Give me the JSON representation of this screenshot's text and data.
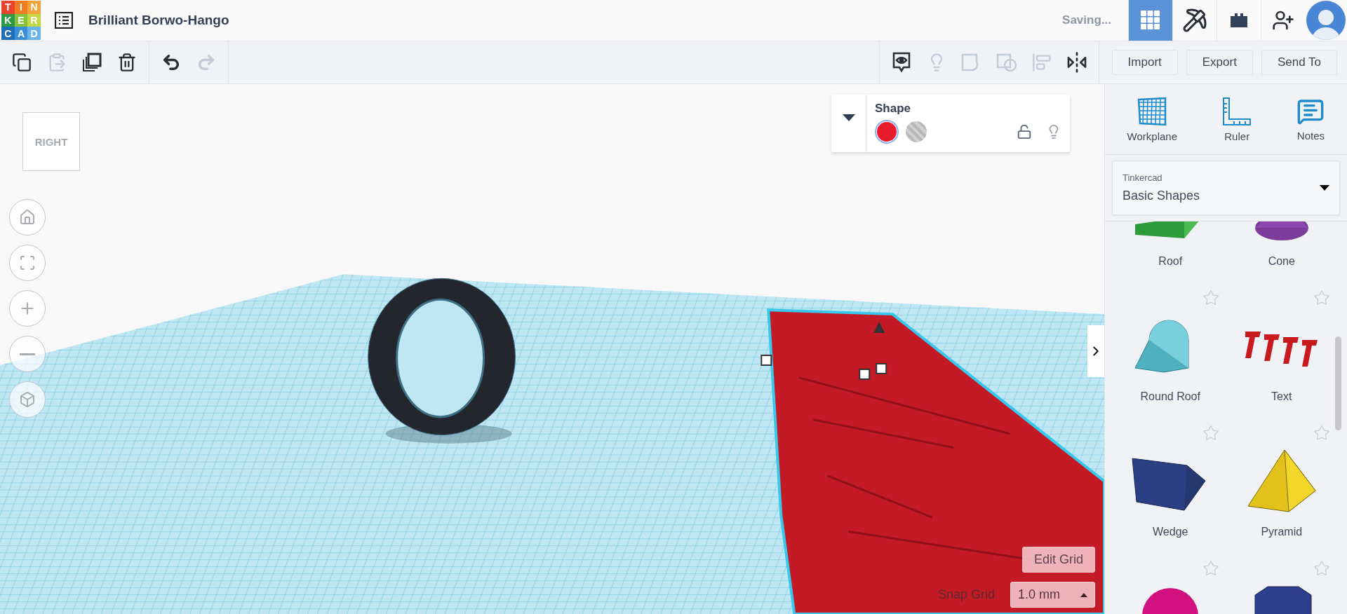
{
  "logo": {
    "letters": [
      "T",
      "I",
      "N",
      "K",
      "E",
      "R",
      "C",
      "A",
      "D"
    ]
  },
  "title": "Brilliant Borwo-Hango",
  "save_status": "Saving...",
  "top_nav": [
    {
      "kind": "grid",
      "selected": true
    },
    {
      "kind": "pickaxe",
      "selected": false
    },
    {
      "kind": "bricks",
      "selected": false
    },
    {
      "kind": "add-user",
      "selected": false
    }
  ],
  "edit_tools": [
    {
      "kind": "copy",
      "disabled": false
    },
    {
      "kind": "paste",
      "disabled": true
    },
    {
      "kind": "duplicate",
      "disabled": false
    },
    {
      "kind": "delete",
      "disabled": false
    }
  ],
  "history_tools": [
    {
      "kind": "undo",
      "disabled": false
    },
    {
      "kind": "redo",
      "disabled": true
    }
  ],
  "view_tools": [
    {
      "kind": "notes-visibility",
      "disabled": false
    },
    {
      "kind": "hint",
      "disabled": true
    },
    {
      "kind": "group",
      "disabled": true
    },
    {
      "kind": "ungroup",
      "disabled": true
    },
    {
      "kind": "align",
      "disabled": true
    },
    {
      "kind": "mirror",
      "disabled": false
    }
  ],
  "buttons": [
    "Import",
    "Export",
    "Send To"
  ],
  "view_cube": {
    "face": "RIGHT"
  },
  "nav_controls": [
    {
      "kind": "home"
    },
    {
      "kind": "fit"
    },
    {
      "kind": "zoom-in"
    },
    {
      "kind": "zoom-out"
    },
    {
      "kind": "ortho"
    }
  ],
  "shape_panel": {
    "title": "Shape",
    "expanded": true,
    "locked": false,
    "colors": [
      {
        "kind": "solid",
        "color": "#e81c2e",
        "selected": true
      },
      {
        "kind": "hole",
        "selected": false
      }
    ]
  },
  "right_tools": [
    {
      "kind": "workplane",
      "label": "Workplane"
    },
    {
      "kind": "ruler",
      "label": "Ruler"
    },
    {
      "kind": "notes",
      "label": "Notes"
    }
  ],
  "library": {
    "provider": "Tinkercad",
    "category": "Basic Shapes"
  },
  "shapes": [
    {
      "kind": "roof",
      "label": "Roof"
    },
    {
      "kind": "cone",
      "label": "Cone"
    },
    {
      "kind": "round-roof",
      "label": "Round Roof",
      "favorite": false
    },
    {
      "kind": "text",
      "label": "Text",
      "favorite": false
    },
    {
      "kind": "wedge",
      "label": "Wedge",
      "favorite": false
    },
    {
      "kind": "pyramid",
      "label": "Pyramid",
      "favorite": false
    },
    {
      "kind": "half-sphere",
      "favorite": false
    },
    {
      "kind": "polygon",
      "favorite": false
    }
  ],
  "grid": {
    "edit_button": "Edit Grid",
    "snap_label": "Snap Grid",
    "snap_value": "1.0 mm"
  }
}
